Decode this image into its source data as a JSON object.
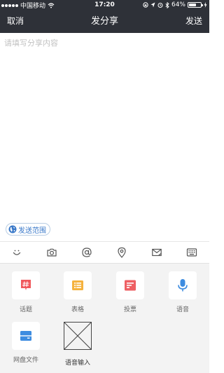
{
  "status_bar": {
    "carrier": "中国移动",
    "time": "17:20",
    "battery_percent": "64%",
    "battery_level": 0.64
  },
  "nav": {
    "cancel": "取消",
    "title": "发分享",
    "send": "发送"
  },
  "compose": {
    "placeholder": "请填写分享内容"
  },
  "scope_button": {
    "label": "发送范围"
  },
  "toolbar": {
    "icons": [
      "smile-icon",
      "camera-icon",
      "at-icon",
      "location-pin-icon",
      "mail-icon",
      "keyboard-icon"
    ]
  },
  "panel": {
    "items": [
      {
        "label": "话题",
        "icon": "hashtag-icon",
        "color": "#f0595c"
      },
      {
        "label": "表格",
        "icon": "table-icon",
        "color": "#f5b23e"
      },
      {
        "label": "投票",
        "icon": "vote-icon",
        "color": "#ee5f63"
      },
      {
        "label": "语音",
        "icon": "microphone-icon",
        "color": "#3d8ce0"
      },
      {
        "label": "网盘文件",
        "icon": "cloud-drive-icon",
        "color": "#3d8ce0"
      },
      {
        "label": "语音输入",
        "icon": "broken-image-icon",
        "color": "#444444"
      }
    ]
  }
}
